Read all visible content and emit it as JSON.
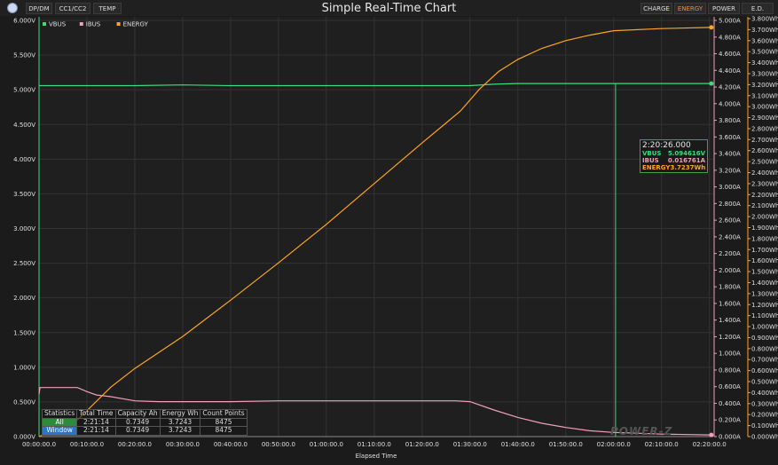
{
  "app": {
    "title": "Simple Real-Time Chart",
    "left_tabs": [
      "DP/DM",
      "CC1/CC2",
      "TEMP"
    ],
    "right_tabs": [
      "CHARGE",
      "ENERGY",
      "POWER",
      "E.D."
    ],
    "active_right_tab": 1,
    "watermark": "POWER-Z"
  },
  "tooltip": {
    "time": "2:20:26.000",
    "rows": [
      {
        "label": "VBUS",
        "value": "5.094616V",
        "color": "#3ddb7a"
      },
      {
        "label": "IBUS",
        "value": "0.016761A",
        "color": "#f0a0b8"
      },
      {
        "label": "ENERGY",
        "value": "3.7237Wh",
        "color": "#ffa51f"
      }
    ]
  },
  "stats": {
    "headers": [
      "Statistics",
      "Total Time",
      "Capacity Ah",
      "Energy Wh",
      "Count Points"
    ],
    "rows": [
      {
        "label": "All",
        "values": [
          "2:21:14",
          "0.7349",
          "3.7243",
          "8475"
        ],
        "color": "#2e8b3e"
      },
      {
        "label": "Window",
        "values": [
          "2:21:14",
          "0.7349",
          "3.7243",
          "8475"
        ],
        "color": "#2a74c9"
      }
    ]
  },
  "chart_data": {
    "type": "line",
    "xlabel": "Elapsed Time",
    "x_ticks": [
      "00:00:00.0",
      "00:10:00.0",
      "00:20:00.0",
      "00:30:00.0",
      "00:40:00.0",
      "00:50:00.0",
      "01:00:00.0",
      "01:10:00.0",
      "01:20:00.0",
      "01:30:00.0",
      "01:40:00.0",
      "01:50:00.0",
      "02:00:00.0",
      "02:10:00.0",
      "02:20:00.0"
    ],
    "xlim_minutes": [
      0,
      140.8
    ],
    "y_left": {
      "ticks": [
        "0.000V",
        "0.500V",
        "1.000V",
        "1.500V",
        "2.000V",
        "2.500V",
        "3.000V",
        "3.500V",
        "4.000V",
        "4.500V",
        "5.000V",
        "5.500V",
        "6.000V"
      ],
      "lim": [
        0,
        6.0
      ]
    },
    "y_mid": {
      "ticks": [
        "0.000A",
        "0.200A",
        "0.400A",
        "0.600A",
        "0.800A",
        "1.000A",
        "1.200A",
        "1.400A",
        "1.600A",
        "1.800A",
        "2.000A",
        "2.200A",
        "2.400A",
        "2.600A",
        "2.800A",
        "3.000A",
        "3.200A",
        "3.400A",
        "3.600A",
        "3.800A",
        "4.000A",
        "4.200A",
        "4.400A",
        "4.600A",
        "4.800A",
        "5.000A"
      ],
      "lim": [
        0,
        5.0
      ]
    },
    "y_right": {
      "ticks": [
        "0.000Wh",
        "0.100Wh",
        "0.200Wh",
        "0.300Wh",
        "0.400Wh",
        "0.500Wh",
        "0.600Wh",
        "0.700Wh",
        "0.800Wh",
        "0.900Wh",
        "1.000Wh",
        "1.100Wh",
        "1.200Wh",
        "1.300Wh",
        "1.400Wh",
        "1.500Wh",
        "1.600Wh",
        "1.700Wh",
        "1.800Wh",
        "1.900Wh",
        "2.000Wh",
        "2.100Wh",
        "2.200Wh",
        "2.300Wh",
        "2.400Wh",
        "2.500Wh",
        "2.600Wh",
        "2.700Wh",
        "2.800Wh",
        "2.900Wh",
        "3.000Wh",
        "3.100Wh",
        "3.200Wh",
        "3.300Wh",
        "3.400Wh",
        "3.500Wh",
        "3.600Wh",
        "3.700Wh",
        "3.800Wh"
      ],
      "lim": [
        0,
        3.8
      ]
    },
    "cursor_minutes": 120.4,
    "series": [
      {
        "name": "VBUS",
        "color": "#3ddb7a",
        "axis": "left",
        "points": [
          [
            0,
            5.06
          ],
          [
            10,
            5.06
          ],
          [
            20,
            5.06
          ],
          [
            30,
            5.07
          ],
          [
            40,
            5.06
          ],
          [
            50,
            5.06
          ],
          [
            60,
            5.06
          ],
          [
            70,
            5.06
          ],
          [
            80,
            5.06
          ],
          [
            90,
            5.06
          ],
          [
            95,
            5.08
          ],
          [
            100,
            5.09
          ],
          [
            110,
            5.09
          ],
          [
            120,
            5.09
          ],
          [
            130,
            5.09
          ],
          [
            140.4,
            5.09
          ]
        ]
      },
      {
        "name": "IBUS",
        "color": "#f0a0b8",
        "axis": "mid",
        "points": [
          [
            0,
            0.51
          ],
          [
            0.2,
            0.59
          ],
          [
            5,
            0.59
          ],
          [
            8,
            0.59
          ],
          [
            10,
            0.54
          ],
          [
            12,
            0.5
          ],
          [
            15,
            0.48
          ],
          [
            20,
            0.43
          ],
          [
            25,
            0.42
          ],
          [
            30,
            0.42
          ],
          [
            40,
            0.42
          ],
          [
            50,
            0.43
          ],
          [
            60,
            0.43
          ],
          [
            70,
            0.43
          ],
          [
            80,
            0.43
          ],
          [
            87,
            0.43
          ],
          [
            90,
            0.42
          ],
          [
            95,
            0.32
          ],
          [
            100,
            0.23
          ],
          [
            105,
            0.16
          ],
          [
            110,
            0.11
          ],
          [
            115,
            0.07
          ],
          [
            120,
            0.05
          ],
          [
            125,
            0.04
          ],
          [
            130,
            0.03
          ],
          [
            140.4,
            0.02
          ]
        ]
      },
      {
        "name": "ENERGY",
        "color": "#ffa51f",
        "axis": "right",
        "points": [
          [
            0,
            0
          ],
          [
            8,
            0.15
          ],
          [
            15,
            0.45
          ],
          [
            20,
            0.62
          ],
          [
            30,
            0.91
          ],
          [
            40,
            1.24
          ],
          [
            50,
            1.58
          ],
          [
            60,
            1.93
          ],
          [
            70,
            2.3
          ],
          [
            80,
            2.67
          ],
          [
            88,
            2.96
          ],
          [
            92,
            3.16
          ],
          [
            96,
            3.32
          ],
          [
            100,
            3.43
          ],
          [
            105,
            3.53
          ],
          [
            110,
            3.6
          ],
          [
            115,
            3.65
          ],
          [
            120,
            3.69
          ],
          [
            130,
            3.71
          ],
          [
            140.4,
            3.72
          ]
        ]
      }
    ]
  }
}
